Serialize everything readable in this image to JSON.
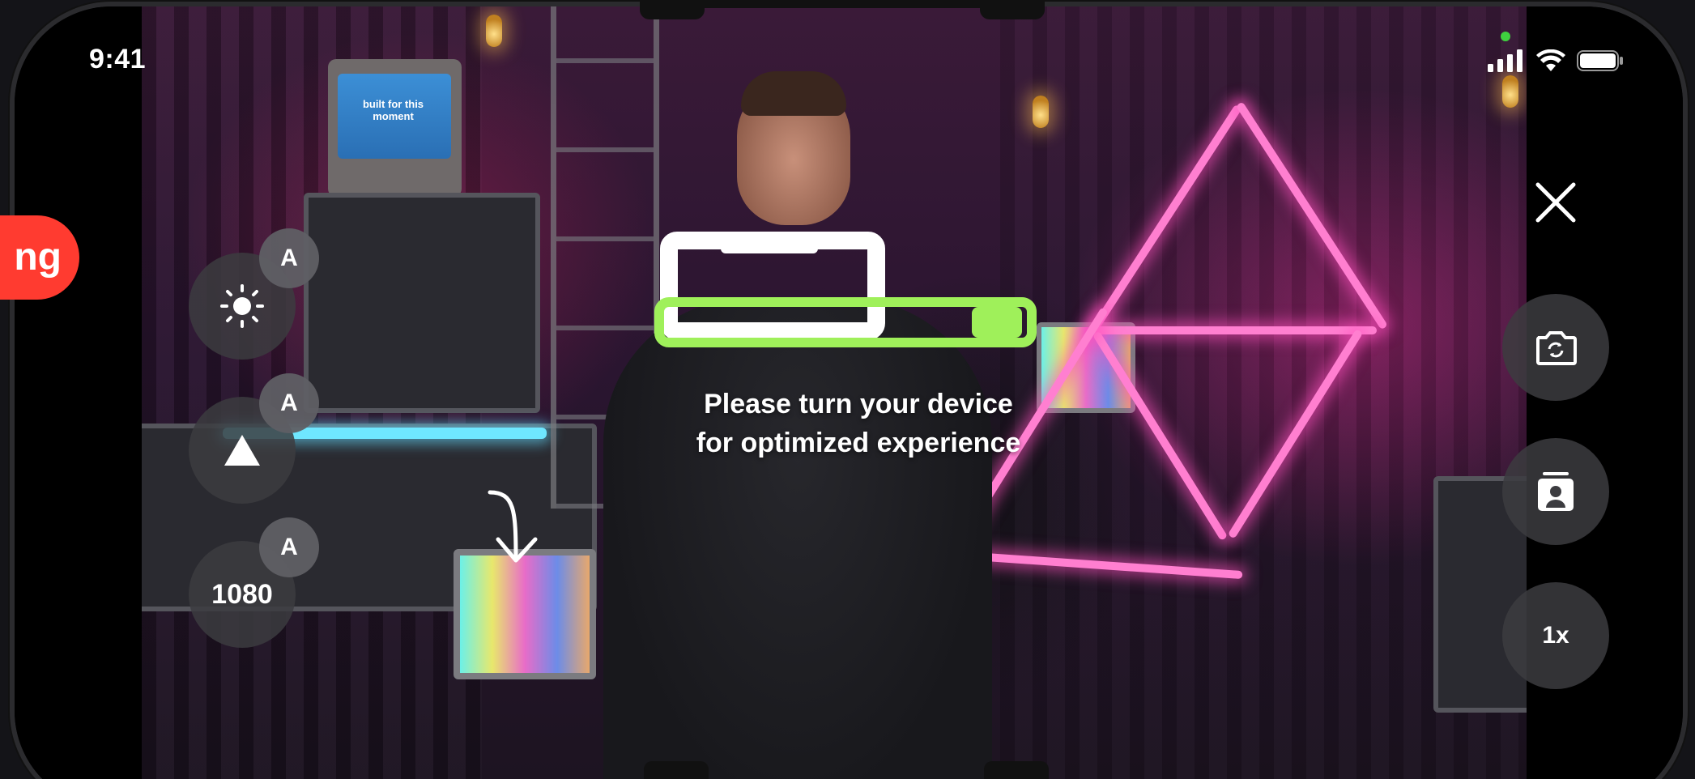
{
  "status_bar": {
    "time": "9:41"
  },
  "recording_pill": {
    "label": "ng"
  },
  "left_controls": {
    "auto_badge": "A",
    "resolution_label": "1080"
  },
  "right_controls": {
    "zoom_label": "1x"
  },
  "scene": {
    "crt_text": "built for this moment"
  },
  "rotate_prompt": {
    "line1": "Please turn your device",
    "line2": "for optimized experience"
  },
  "colors": {
    "record_red": "#ff3b30",
    "accent_green": "#9ff05a",
    "button_bg": "#3c3c40"
  }
}
